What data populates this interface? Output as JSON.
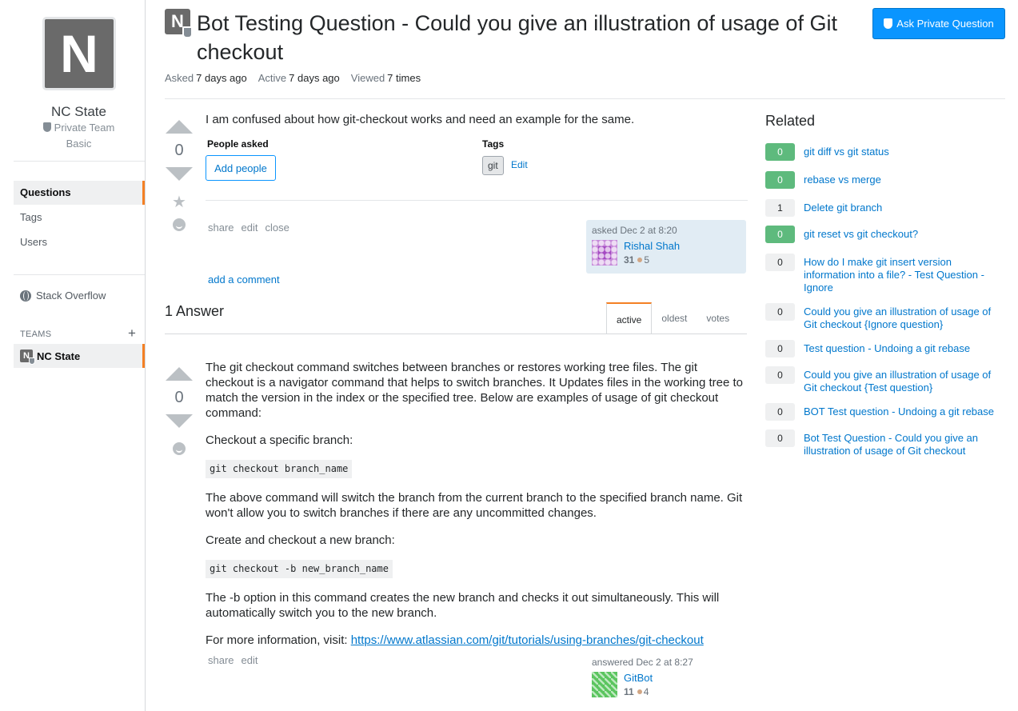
{
  "sidebar": {
    "team_initial": "N",
    "team_name": "NC State",
    "team_type": "Private Team",
    "team_plan": "Basic",
    "nav": [
      {
        "label": "Questions"
      },
      {
        "label": "Tags"
      },
      {
        "label": "Users"
      }
    ],
    "stack_overflow_label": "Stack Overflow",
    "teams_label": "TEAMS",
    "teams_add": "+",
    "team_link": {
      "initial": "N",
      "label": "NC State"
    }
  },
  "question": {
    "avatar_initial": "N",
    "title": "Bot Testing Question - Could you give an illustration of usage of Git checkout",
    "ask_button": "Ask Private Question",
    "meta": {
      "asked_label": "Asked",
      "asked_value": "7 days ago",
      "active_label": "Active",
      "active_value": "7 days ago",
      "viewed_label": "Viewed",
      "viewed_value": "7 times"
    },
    "votes": "0",
    "body": "I am confused about how git-checkout works and need an example for the same.",
    "people_asked_label": "People asked",
    "add_people": "Add people",
    "tags_label": "Tags",
    "tags": [
      "git"
    ],
    "tags_edit": "Edit",
    "menu": [
      "share",
      "edit",
      "close"
    ],
    "owner": {
      "action": "asked Dec 2 at 8:20",
      "name": "Rishal Shah",
      "rep": "31",
      "bronze": "5"
    },
    "add_comment": "add a comment"
  },
  "answers": {
    "count_label": "1 Answer",
    "tabs": [
      "active",
      "oldest",
      "votes"
    ],
    "items": [
      {
        "votes": "0",
        "p1": "The git checkout command switches between branches or restores working tree files. The git checkout is a navigator command that helps to switch branches. It Updates files in the working tree to match the version in the index or the specified tree. Below are examples of usage of git checkout command:",
        "p2": "Checkout a specific branch:",
        "code1": "git checkout branch_name",
        "p3": "The above command will switch the branch from the current branch to the specified branch name. Git won't allow you to switch branches if there are any uncommitted changes.",
        "p4": "Create and checkout a new branch:",
        "code2": "git checkout -b new_branch_name",
        "p5": "The -b option in this command creates the new branch and checks it out simultaneously. This will automatically switch you to the new branch.",
        "p6_prefix": "For more information, visit: ",
        "link": "https://www.atlassian.com/git/tutorials/using-branches/git-checkout",
        "menu": [
          "share",
          "edit"
        ],
        "owner": {
          "action": "answered Dec 2 at 8:27",
          "name": "GitBot",
          "rep": "11",
          "bronze": "4"
        }
      }
    ]
  },
  "related": {
    "title": "Related",
    "items": [
      {
        "score": "0",
        "answered": true,
        "text": "git diff vs git status"
      },
      {
        "score": "0",
        "answered": true,
        "text": "rebase vs merge"
      },
      {
        "score": "1",
        "answered": false,
        "text": "Delete git branch"
      },
      {
        "score": "0",
        "answered": true,
        "text": "git reset vs git checkout?"
      },
      {
        "score": "0",
        "answered": false,
        "text": "How do I make git insert version information into a file? - Test Question - Ignore"
      },
      {
        "score": "0",
        "answered": false,
        "text": "Could you give an illustration of usage of Git checkout {Ignore question}"
      },
      {
        "score": "0",
        "answered": false,
        "text": "Test question - Undoing a git rebase"
      },
      {
        "score": "0",
        "answered": false,
        "text": "Could you give an illustration of usage of Git checkout {Test question}"
      },
      {
        "score": "0",
        "answered": false,
        "text": "BOT Test question - Undoing a git rebase"
      },
      {
        "score": "0",
        "answered": false,
        "text": "Bot Test Question - Could you give an illustration of usage of Git checkout"
      }
    ]
  },
  "colors": {
    "accent": "#0a95ff",
    "link": "#0077cc",
    "answered_green": "#5eba7d",
    "nav_active_border": "#f48024"
  }
}
